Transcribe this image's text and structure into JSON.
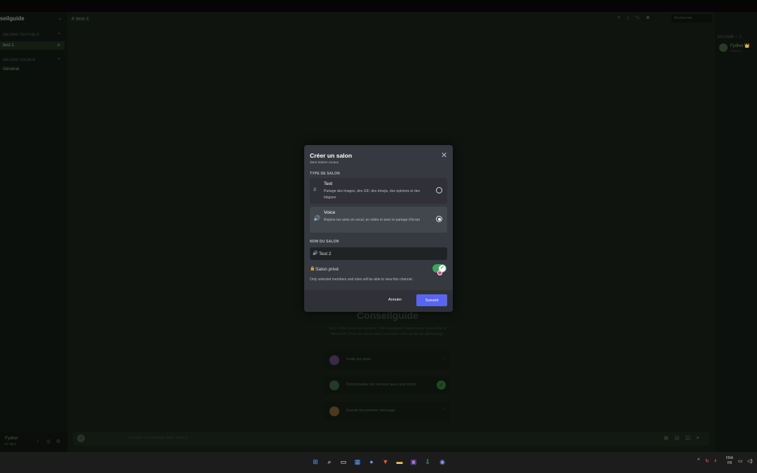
{
  "sidebar": {
    "server_name": "seilguide",
    "categories": [
      {
        "label": "SALONS TEXTUELS"
      },
      {
        "label": "SALONS VOCAUX"
      }
    ],
    "channels": [
      {
        "label": "test-1",
        "active": true
      },
      {
        "label": "Général",
        "active": false
      }
    ],
    "user": {
      "name": "Fydher",
      "status": "En ligne"
    }
  },
  "header": {
    "channel": "test-1",
    "search_placeholder": "Rechercher"
  },
  "members": {
    "category": "EN LIGNE — 1",
    "items": [
      {
        "name": "Fydher 👑",
        "status": "Joue à..."
      }
    ]
  },
  "welcome": {
    "title": "Conseilguide",
    "subtitle": "Voici votre nouveau serveur. Voici quelques étapes pour vous aider à démarrer. Pour en savoir plus, consulte notre guide de démarrage.",
    "tasks": [
      {
        "label": "Invite tes amis",
        "done": false
      },
      {
        "label": "Personnalise ton serveur avec une icône",
        "done": true
      },
      {
        "label": "Envoie ton premier message",
        "done": false
      }
    ]
  },
  "composer": {
    "placeholder": "Envoyer un message dans #test-1"
  },
  "modal": {
    "title": "Créer un salon",
    "subtitle": "dans Salons vocaux",
    "type_section": "TYPE DE SALON",
    "options": [
      {
        "name": "Text",
        "icon": "hash-icon",
        "description": "Partage des images, des GIF, des émojis, des opinions et des blagues",
        "selected": false
      },
      {
        "name": "Voice",
        "icon": "speaker-icon",
        "description": "Rejoins tes amis en vocal, en vidéo et avec le partage d'écran",
        "selected": true
      }
    ],
    "name_section": "NOM DU SALON",
    "name_value": "Test 2",
    "private_label": "Salon privé",
    "private_description": "Only selected members and roles will be able to view this channel.",
    "private_enabled": true,
    "cancel_label": "Annuler",
    "next_label": "Suivant",
    "accent_color": "#5865f2",
    "toggle_color": "#3ba55d"
  },
  "taskbar": {
    "language": "FRA",
    "region": "FR"
  }
}
